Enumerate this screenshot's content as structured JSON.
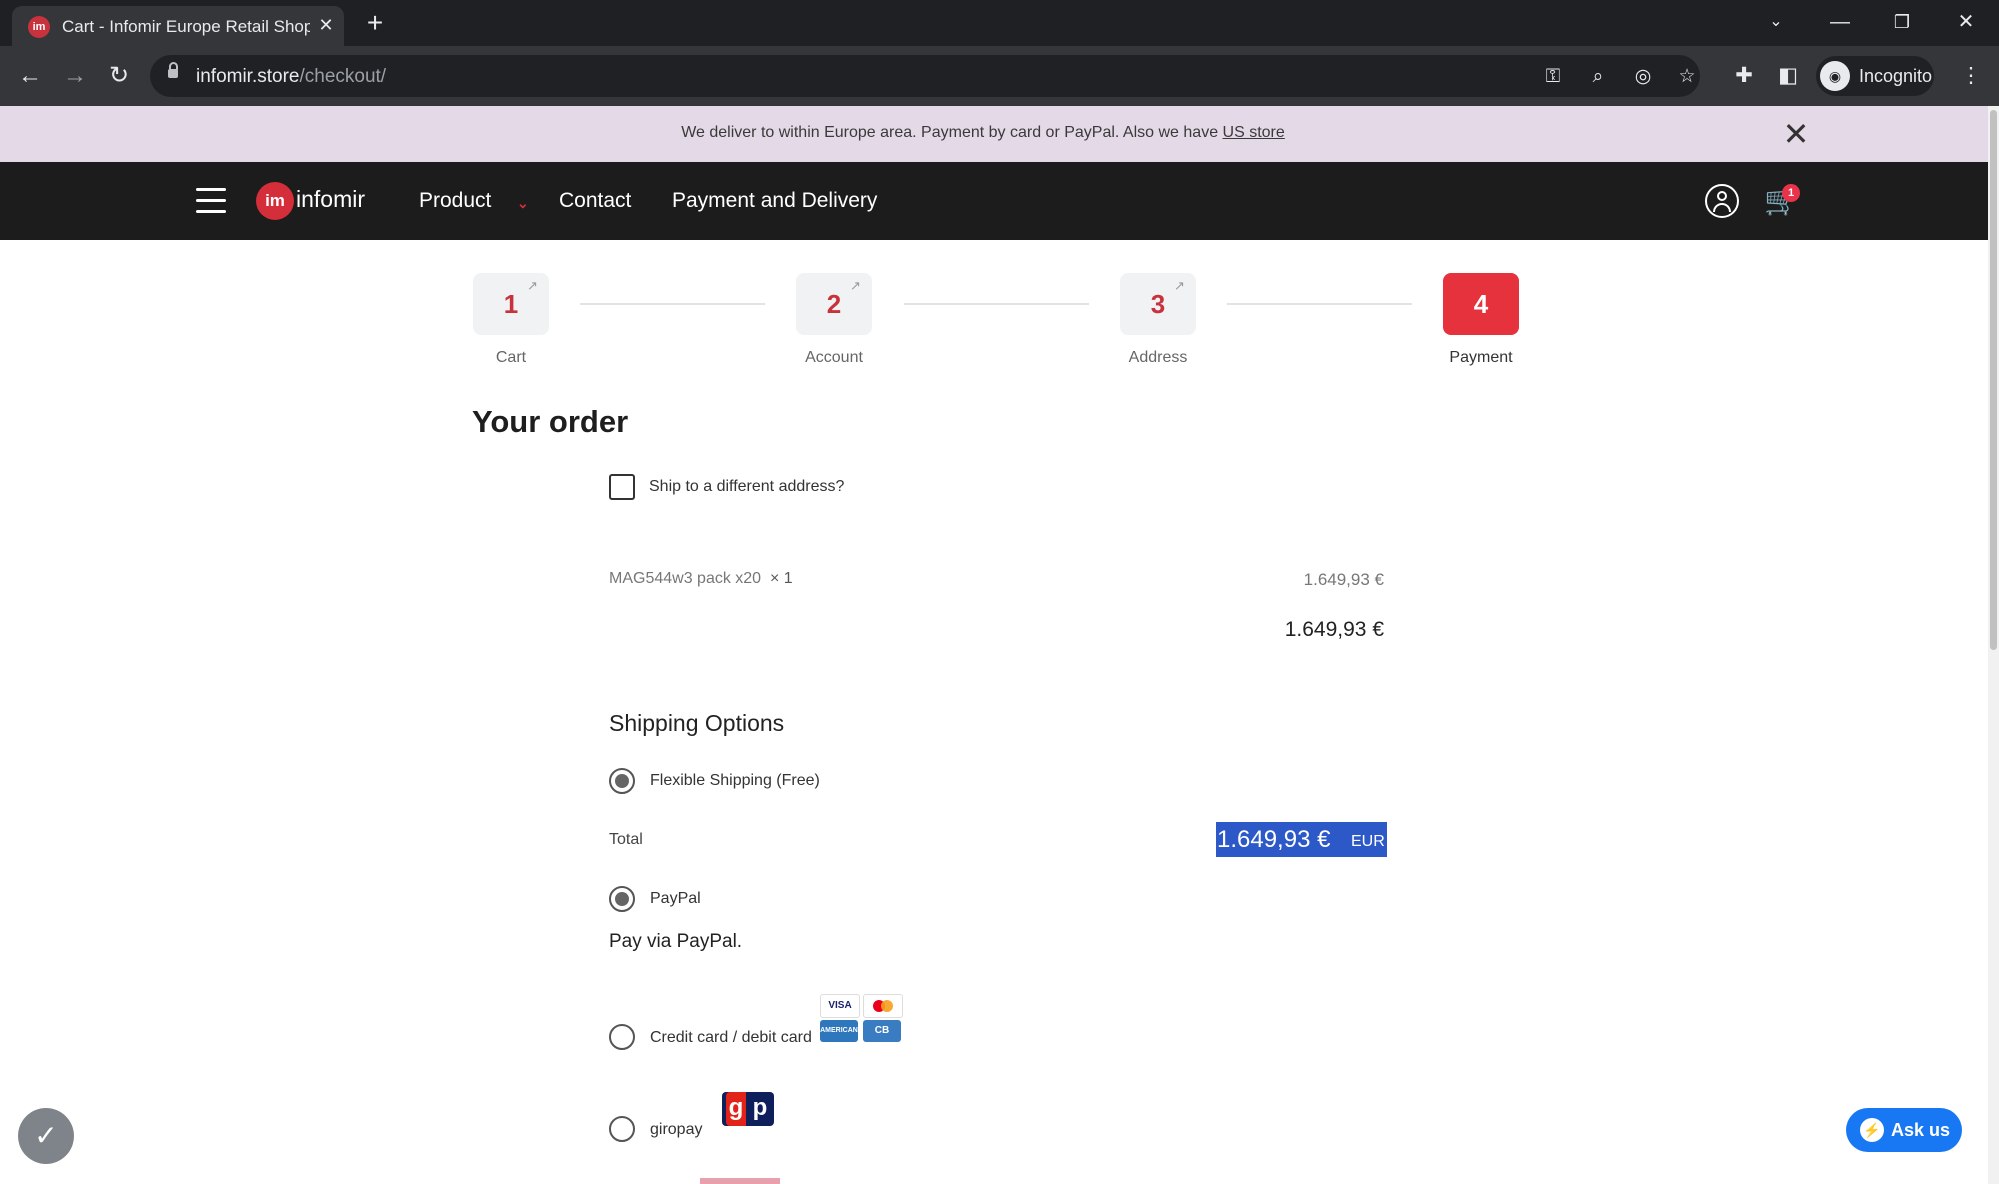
{
  "browser": {
    "tab_title": "Cart - Infomir Europe Retail Shop",
    "url_host": "infomir.store",
    "url_path": "/checkout/",
    "profile_label": "Incognito"
  },
  "notice": {
    "text": "We deliver to within Europe area. Payment by card or PayPal. Also we have ",
    "link": "US store"
  },
  "header": {
    "logo_mark": "im",
    "logo_text": "infomir",
    "nav": [
      "Product",
      "Contact",
      "Payment and Delivery"
    ],
    "cart_count": "1"
  },
  "steps": [
    {
      "num": "1",
      "label": "Cart"
    },
    {
      "num": "2",
      "label": "Account"
    },
    {
      "num": "3",
      "label": "Address"
    },
    {
      "num": "4",
      "label": "Payment",
      "active": true
    }
  ],
  "order": {
    "title": "Your order",
    "ship_different": "Ship to a different address?",
    "item_name": "MAG544w3 pack x20",
    "item_qty": "× 1",
    "item_price": "1.649,93 €",
    "subtotal": "1.649,93 €"
  },
  "shipping": {
    "title": "Shipping Options",
    "option": "Flexible Shipping (Free)"
  },
  "total": {
    "label": "Total",
    "amount": "1.649,93 €",
    "currency": "EUR"
  },
  "payment": {
    "paypal_label": "PayPal",
    "paypal_desc": "Pay via PayPal.",
    "card_label": "Credit card / debit card",
    "giropay_label": "giropay",
    "card_logos": [
      "VISA",
      "AMERICAN EXPRESS",
      "CB"
    ]
  },
  "chat": {
    "label": "Ask us"
  },
  "colors": {
    "brand_red": "#e6323d",
    "selection_blue": "#2c58c8",
    "notice_bg": "#e4d9e6",
    "header_bg": "#1c1c1c"
  }
}
